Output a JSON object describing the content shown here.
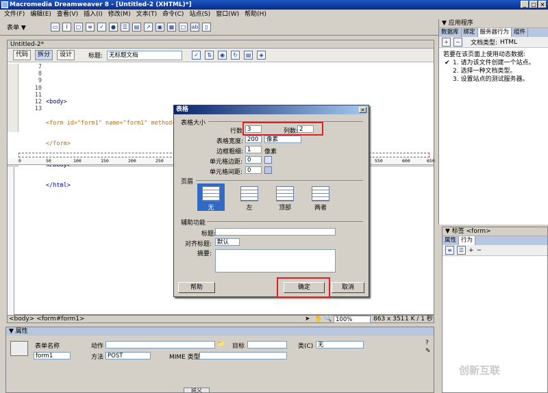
{
  "window": {
    "title": "Macromedia Dreamweaver 8 - [Untitled-2 (XHTML)*]",
    "min": "_",
    "max": "□",
    "close": "×"
  },
  "menu": [
    "文件(F)",
    "编辑(E)",
    "查看(V)",
    "插入(I)",
    "修改(M)",
    "文本(T)",
    "命令(C)",
    "站点(S)",
    "窗口(W)",
    "帮助(H)"
  ],
  "insertbar": {
    "category": "表单 ▼"
  },
  "apppanel": {
    "header": "▼ 应用程序",
    "tabs": [
      "数据库",
      "绑定",
      "服务器行为",
      "组件"
    ],
    "doctype_label": "文档类型:",
    "doctype_value": "HTML",
    "intro": "若要在该页面上使用动态数据:",
    "steps": [
      "1. 请为该文件创建一个站点。",
      "2. 选择一种文档类型。",
      "3. 设置站点的测试服务器。"
    ]
  },
  "doc": {
    "tab": "Untitled-2*",
    "code_btn": "代码",
    "split_btn": "拆分",
    "design_btn": "设计",
    "title_label": "标题:",
    "title_value": "无标题文档",
    "line_numbers": [
      "7",
      "8",
      "9",
      "10",
      "11",
      "12",
      "13"
    ],
    "code_lines": [
      "",
      "<body>",
      "<form id=\"form1\" name=\"form1\" method=\"post\" action=\"\">",
      "</form>",
      "</body>",
      "</html>",
      ""
    ],
    "ruler": [
      "0",
      "50",
      "100",
      "150",
      "200",
      "250",
      "300",
      "550",
      "600",
      "650"
    ]
  },
  "status": {
    "tags": "<body> <form#form1>",
    "zoom": "100%",
    "size": "863 x 351",
    "filesize": "1 K / 1 秒"
  },
  "dialog": {
    "title": "表格",
    "size_group": "表格大小",
    "rows_label": "行数:",
    "rows_value": "3",
    "cols_label": "列数:",
    "cols_value": "2",
    "width_label": "表格宽度:",
    "width_value": "200",
    "width_unit": "像素",
    "border_label": "边框粗细:",
    "border_value": "1",
    "border_unit": "像素",
    "padding_label": "单元格边距:",
    "padding_value": "0",
    "spacing_label": "单元格间距:",
    "spacing_value": "0",
    "header_group": "页眉",
    "header_options": [
      "无",
      "左",
      "顶部",
      "两者"
    ],
    "access_group": "辅助功能",
    "caption_label": "标题:",
    "align_label": "对齐标题:",
    "align_value": "默认",
    "summary_label": "摘要:",
    "help": "帮助",
    "ok": "确定",
    "cancel": "取消"
  },
  "props": {
    "header": "▼ 属性",
    "form_name_label": "表单名称",
    "form_name_value": "form1",
    "action_label": "动作",
    "target_label": "目标",
    "method_label": "方法",
    "method_value": "POST",
    "mime_label": "MIME 类型",
    "class_label": "类(C)",
    "class_value": "无"
  },
  "tagpanel": {
    "header": "▼ 标签 <form>",
    "tabs": [
      "属性",
      "行为"
    ]
  },
  "bottom": {
    "submit": "提交"
  },
  "watermark": "创新互联"
}
